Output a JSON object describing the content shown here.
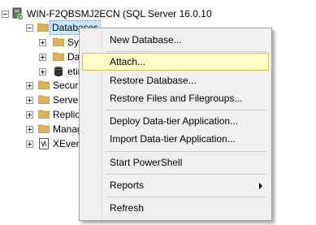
{
  "tree": {
    "server_label": "WIN-F2QBSMJ2ECN (SQL Server 16.0.10",
    "databases_label": "Databases",
    "children": [
      {
        "label": "Sys"
      },
      {
        "label": "Da"
      },
      {
        "label": "etin"
      }
    ],
    "nodes": [
      {
        "label": "Securit"
      },
      {
        "label": "Server"
      },
      {
        "label": "Replica"
      },
      {
        "label": "Manag"
      },
      {
        "label": "XEvent"
      }
    ]
  },
  "context_menu": {
    "new_database": "New Database...",
    "attach": "Attach...",
    "restore_database": "Restore Database...",
    "restore_files": "Restore Files and Filegroups...",
    "deploy_dac": "Deploy Data-tier Application...",
    "import_dac": "Import Data-tier Application...",
    "start_powershell": "Start PowerShell",
    "reports": "Reports",
    "refresh": "Refresh",
    "highlighted_item": "Attach..."
  },
  "colors": {
    "highlight_bg": "#fffcc8",
    "highlight_border": "#d5c05a",
    "selection_bg": "#cce8ff",
    "folder": "#dcb35c"
  }
}
